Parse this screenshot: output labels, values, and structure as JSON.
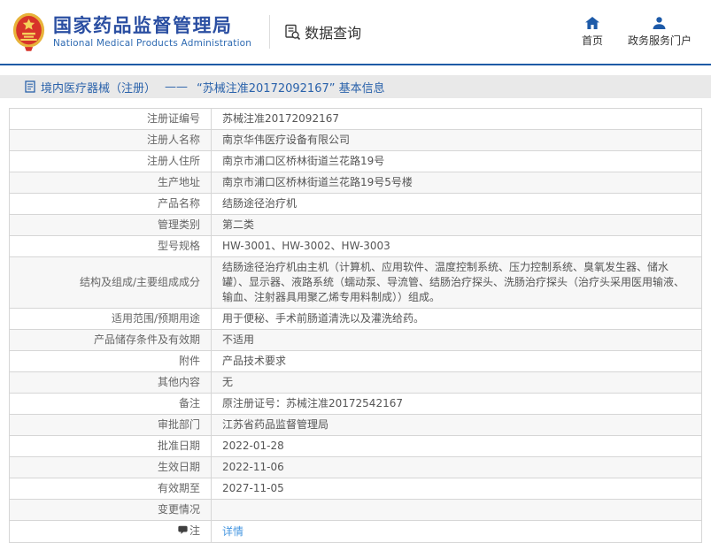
{
  "header": {
    "title_cn": "国家药品监督管理局",
    "title_en": "National Medical Products Administration",
    "section_label": "数据查询",
    "nav_home_label": "首页",
    "nav_portal_label": "政务服务门户"
  },
  "breadcrumb": {
    "section": "境内医疗器械（注册）",
    "separator": "——",
    "current": "“苏械注准20172092167” 基本信息"
  },
  "table": {
    "rows": [
      {
        "label": "注册证编号",
        "value": "苏械注准20172092167"
      },
      {
        "label": "注册人名称",
        "value": "南京华伟医疗设备有限公司"
      },
      {
        "label": "注册人住所",
        "value": "南京市浦口区桥林街道兰花路19号"
      },
      {
        "label": "生产地址",
        "value": "南京市浦口区桥林街道兰花路19号5号楼"
      },
      {
        "label": "产品名称",
        "value": "结肠途径治疗机"
      },
      {
        "label": "管理类别",
        "value": "第二类"
      },
      {
        "label": "型号规格",
        "value": "HW-3001、HW-3002、HW-3003"
      },
      {
        "label": "结构及组成/主要组成成分",
        "value": "结肠途径治疗机由主机（计算机、应用软件、温度控制系统、压力控制系统、臭氧发生器、储水罐）、显示器、液路系统（蠕动泵、导流管、结肠治疗探头、洗肠治疗探头（治疗头采用医用输液、输血、注射器具用聚乙烯专用料制成））组成。"
      },
      {
        "label": "适用范围/预期用途",
        "value": "用于便秘、手术前肠道清洗以及灌洗给药。"
      },
      {
        "label": "产品储存条件及有效期",
        "value": "不适用"
      },
      {
        "label": "附件",
        "value": "产品技术要求"
      },
      {
        "label": "其他内容",
        "value": "无"
      },
      {
        "label": "备注",
        "value": "原注册证号：苏械注准20172542167"
      },
      {
        "label": "审批部门",
        "value": "江苏省药品监督管理局"
      },
      {
        "label": "批准日期",
        "value": "2022-01-28"
      },
      {
        "label": "生效日期",
        "value": "2022-11-06"
      },
      {
        "label": "有效期至",
        "value": "2027-11-05"
      },
      {
        "label": "变更情况",
        "value": ""
      },
      {
        "label": "注",
        "value": "详情",
        "is_link": true,
        "has_icon": true
      }
    ]
  },
  "colors": {
    "title_blue": "#2b4fa2",
    "english_blue": "#2e6ab2",
    "nav_icon_blue": "#1d5aa8",
    "header_rule_blue": "#1f5ba6",
    "breadcrumb_bg": "#e9e9e9",
    "breadcrumb_text": "#2a62ab",
    "link_blue": "#4596e0",
    "table_border": "#d6d6d6",
    "row_alt_bg": "#f7f7f7",
    "emblem_red": "#d7342a",
    "emblem_gold": "#f0c34a"
  }
}
